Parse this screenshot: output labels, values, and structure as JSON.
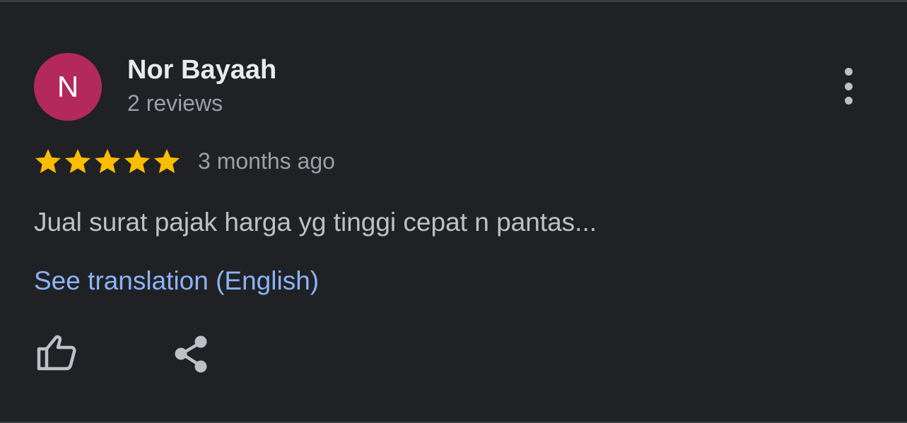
{
  "review": {
    "avatar": {
      "initial": "N",
      "color": "#b3295a"
    },
    "reviewer_name": "Nor Bayaah",
    "review_count": "2 reviews",
    "rating": 5,
    "rating_max": 5,
    "star_color": "#fbbc04",
    "timestamp": "3 months ago",
    "text": "Jual surat pajak harga yg tinggi cepat n pantas...",
    "translation_link": "See translation (English)"
  },
  "actions": {
    "more_icon": "more-vert-icon",
    "like_icon": "thumb-up-icon",
    "share_icon": "share-icon"
  },
  "theme": {
    "background": "#202124",
    "link_color": "#8ab4f8",
    "secondary_text": "#9aa0a6",
    "icon_color": "#bdc1c6"
  }
}
